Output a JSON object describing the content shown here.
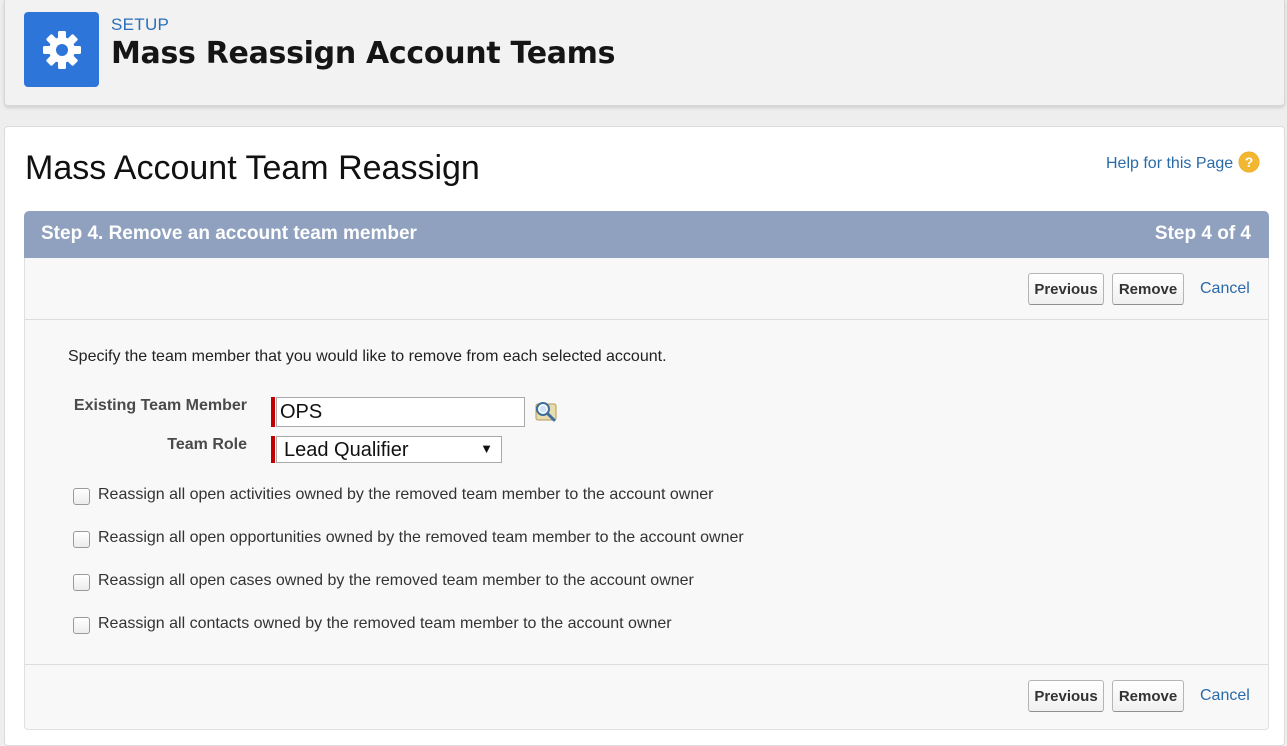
{
  "header": {
    "section_label": "SETUP",
    "title": "Mass Reassign Account Teams",
    "icon": "gear-icon"
  },
  "page": {
    "title": "Mass Account Team Reassign",
    "help_link": "Help for this Page",
    "help_icon": "question-circle-icon"
  },
  "step": {
    "title": "Step 4. Remove an account team member",
    "count": "Step 4 of 4"
  },
  "buttons": {
    "previous": "Previous",
    "remove": "Remove",
    "cancel": "Cancel"
  },
  "form": {
    "instructions": "Specify the team member that you would like to remove from each selected account.",
    "existing_member_label": "Existing Team Member",
    "existing_member_value": "OPS",
    "team_role_label": "Team Role",
    "team_role_value": "Lead Qualifier"
  },
  "options": [
    {
      "label": "Reassign all open activities owned by the removed team member to the account owner",
      "checked": false
    },
    {
      "label": "Reassign all open opportunities owned by the removed team member to the account owner",
      "checked": false
    },
    {
      "label": "Reassign all open cases owned by the removed team member to the account owner",
      "checked": false
    },
    {
      "label": "Reassign all contacts owned by the removed team member to the account owner",
      "checked": false
    }
  ],
  "colors": {
    "accent": "#2d75d8",
    "step_bar": "#8fa1bf",
    "required": "#c00000",
    "link": "#2a6aa8"
  }
}
